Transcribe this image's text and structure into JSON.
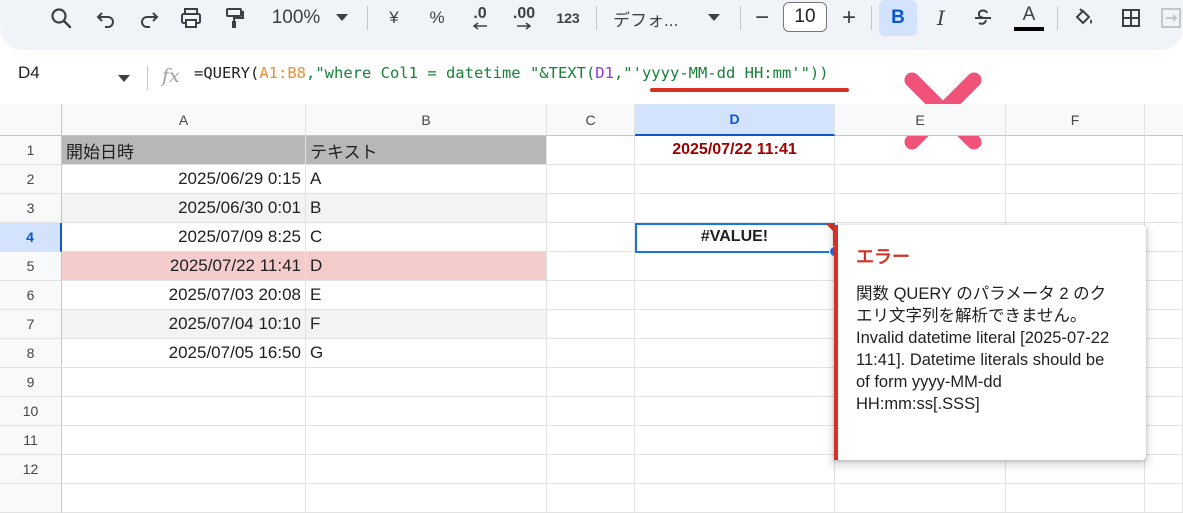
{
  "toolbar": {
    "zoom": "100%",
    "currency": "¥",
    "percent": "%",
    "decimal_decrease": ".0",
    "decimal_increase": ".00",
    "number_format": "123",
    "font_name": "デフォ...",
    "font_size": "10",
    "minus": "−",
    "plus": "+",
    "bold": "B",
    "italic": "I",
    "text_color_label": "A"
  },
  "formula_bar": {
    "cell_ref": "D4",
    "fx": "fx",
    "formula_parts": [
      "=QUERY(",
      "A1:B8",
      ",\"where Col1 = datetime \"&TEXT(",
      "D1",
      ",\"'yyyy-MM-dd HH:mm'\"))"
    ]
  },
  "columns": [
    "A",
    "B",
    "C",
    "D",
    "E",
    "F"
  ],
  "rows": [
    "1",
    "2",
    "3",
    "4",
    "5",
    "6",
    "7",
    "8",
    "9",
    "10",
    "11",
    "12"
  ],
  "sheet": {
    "header": {
      "a": "開始日時",
      "b": "テキスト"
    },
    "data": [
      {
        "a": "2025/06/29 0:15",
        "b": "A"
      },
      {
        "a": "2025/06/30 0:01",
        "b": "B"
      },
      {
        "a": "2025/07/09 8:25",
        "b": "C"
      },
      {
        "a": "2025/07/22 11:41",
        "b": "D"
      },
      {
        "a": "2025/07/03 20:08",
        "b": "E"
      },
      {
        "a": "2025/07/04 10:10",
        "b": "F"
      },
      {
        "a": "2025/07/05 16:50",
        "b": "G"
      }
    ],
    "d1": "2025/07/22 11:41",
    "d4": "#VALUE!"
  },
  "error_popup": {
    "title": "エラー",
    "message": "関数 QUERY のパラメータ 2 のクエリ文字列を解析できません。Invalid datetime literal [2025-07-22 11:41]. Datetime literals should be of form yyyy-MM-dd HH:mm:ss[.SSS]"
  },
  "colors": {
    "error_red": "#d93025",
    "result_dark_red": "#990000",
    "selection_blue": "#1a73e8",
    "header_gray": "#b7b7b7",
    "highlight_pink": "#f4cccc"
  }
}
